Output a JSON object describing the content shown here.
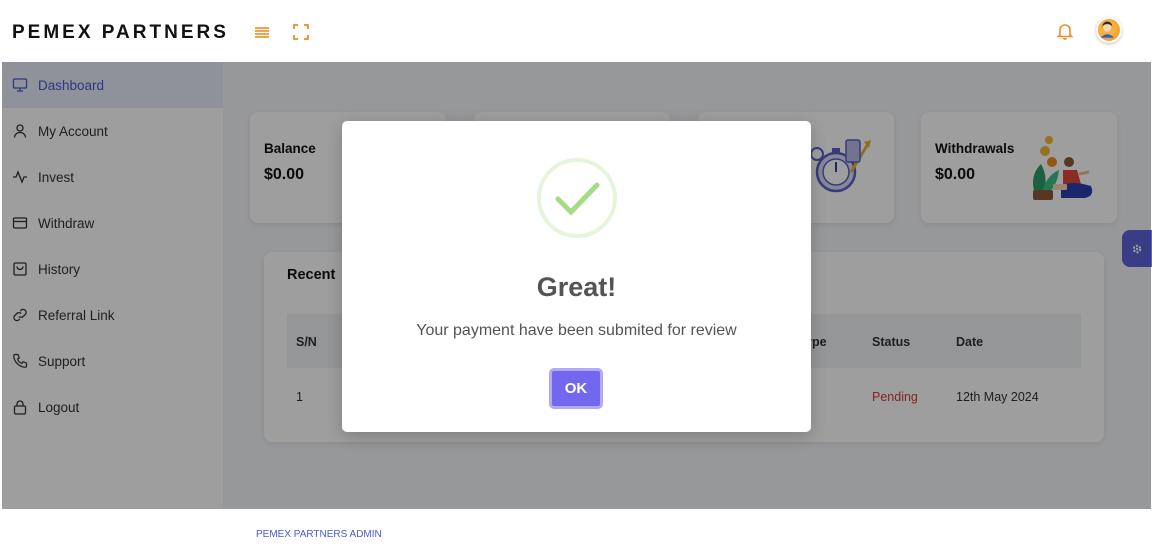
{
  "app": {
    "brand": "PEMEX PARTNERS"
  },
  "header": {
    "icons": [
      "menu-icon",
      "expand-icon",
      "bell-icon",
      "avatar"
    ]
  },
  "sidebar": {
    "items": [
      {
        "label": "Dashboard",
        "icon": "monitor-icon",
        "active": true
      },
      {
        "label": "My Account",
        "icon": "user-icon"
      },
      {
        "label": "Invest",
        "icon": "activity-icon"
      },
      {
        "label": "Withdraw",
        "icon": "credit-card-icon"
      },
      {
        "label": "History",
        "icon": "shopping-bag-icon"
      },
      {
        "label": "Referral Link",
        "icon": "link-icon"
      },
      {
        "label": "Support",
        "icon": "phone-icon"
      },
      {
        "label": "Logout",
        "icon": "lock-icon"
      }
    ]
  },
  "cards": [
    {
      "label": "Balance",
      "value": "$0.00"
    },
    {
      "label": "",
      "value": ""
    },
    {
      "label": "",
      "value": ""
    },
    {
      "label": "Withdrawals",
      "value": "$0.00"
    }
  ],
  "recent": {
    "title": "Recent",
    "columns": [
      "S/N",
      "ype",
      "Status",
      "Date"
    ],
    "rows": [
      {
        "sn": "1",
        "status": "Pending",
        "date": "12th May 2024"
      }
    ]
  },
  "footer": {
    "text": "PEMEX PARTNERS ADMIN"
  },
  "modal": {
    "title": "Great!",
    "message": "Your payment have been submited for review",
    "ok_label": "OK"
  },
  "colors": {
    "accent": "#7367f0",
    "brand_link": "#4a5ad0",
    "pending": "#d23a3a",
    "success": "#a5dc86",
    "header_icons": "#f08a24"
  }
}
